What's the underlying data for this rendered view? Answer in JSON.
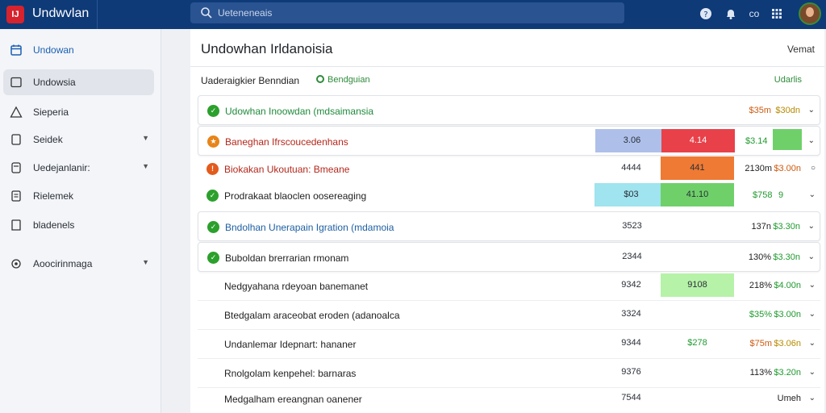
{
  "app": {
    "title": "Undwvlan",
    "logo": "IJ"
  },
  "search": {
    "placeholder": "Ueteneneais"
  },
  "topbar_icons": [
    "help-icon",
    "bell-icon",
    "code-icon",
    "apps-grid-icon",
    "avatar"
  ],
  "topbar": {
    "code_label": "co"
  },
  "sidebar": {
    "items": [
      {
        "label": "Undowan",
        "icon": "calendar-icon",
        "caret": false
      },
      {
        "label": "Undowsia",
        "icon": "folder-icon",
        "caret": false
      },
      {
        "label": "Sieperia",
        "icon": "warning-icon",
        "caret": false
      },
      {
        "label": "Seidek",
        "icon": "document-icon",
        "caret": true
      },
      {
        "label": "Uedejanlanir:",
        "icon": "database-icon",
        "caret": true
      },
      {
        "label": "Rielemek",
        "icon": "list-icon",
        "caret": false
      },
      {
        "label": "bladenels",
        "icon": "file-icon",
        "caret": false
      },
      {
        "label": "Aoocirinmaga",
        "icon": "settings-icon",
        "caret": true
      }
    ]
  },
  "panel": {
    "title": "Undowhan Irldanoisia",
    "action": "Vemat",
    "group_heading": "Uaderaigkier Benndian",
    "group_chip": "Bendguian",
    "group_status": "Udarlis"
  },
  "rows": [
    {
      "name": "Udowhan Inoowdan (mdsaimansia",
      "status": "check",
      "cell_a": "",
      "cell_b": "",
      "val1": "$35m",
      "val2": "$30dn"
    },
    {
      "name": "Baneghan Ifrscoucedenhans",
      "status": "warn",
      "cell_a": "3.06",
      "cell_b": "4.14",
      "val1": "$3.14",
      "val2": ""
    },
    {
      "name": "Biokakan Ukoutuan: Bmeane",
      "status": "warn",
      "cell_a": "4444",
      "cell_b": "441",
      "val1": "2130m",
      "val2": "$3.00n"
    },
    {
      "name": "Prodrakaat blaoclen oosereaging",
      "status": "check",
      "cell_a": "$03",
      "cell_b": "41.10",
      "val1": "$758",
      "val2": "9"
    },
    {
      "name": "Bndolhan Unerapain Igration (mdamoia",
      "status": "check",
      "cell_a": "3523",
      "cell_b": "",
      "val1": "137n",
      "val2": "$3.30n"
    },
    {
      "name": "Buboldan brerrarian rmonam",
      "status": "check",
      "cell_a": "2344",
      "cell_b": "",
      "val1": "130%",
      "val2": "$3.30n"
    },
    {
      "name": "Nedgyahana rdeyoan banemanet",
      "status": "none",
      "cell_a": "9342",
      "cell_b": "9108",
      "val1": "218%",
      "val2": "$4.00n"
    },
    {
      "name": "Btedgalam araceobat eroden (adanoalca",
      "status": "none",
      "cell_a": "3324",
      "cell_b": "",
      "val1": "$35%",
      "val2": "$3.00n"
    },
    {
      "name": "Undanlemar Idepnart: hananer",
      "status": "none",
      "cell_a": "9344",
      "cell_b": "$278",
      "val1": "$75m",
      "val2": "$3.06n"
    },
    {
      "name": "Rnolgolam kenpehel: barnaras",
      "status": "none",
      "cell_a": "9376",
      "cell_b": "",
      "val1": "113%",
      "val2": "$3.20n"
    },
    {
      "name": "Medgalham ereangnan oanener",
      "status": "none",
      "cell_a": "7544",
      "cell_b": "",
      "val1": "",
      "val2": "Umeh"
    }
  ],
  "colors": {
    "topbar": "#0e3a78",
    "cell_lavender": "#aec0ea",
    "cell_red": "#e8414a",
    "cell_orange": "#ef7a33",
    "cell_cyan": "#9fe4ee",
    "cell_green": "#6fd06a",
    "cell_lightgreen": "#b6f2a8",
    "text_green": "#1f9a2e",
    "text_orange": "#cf5a10"
  }
}
